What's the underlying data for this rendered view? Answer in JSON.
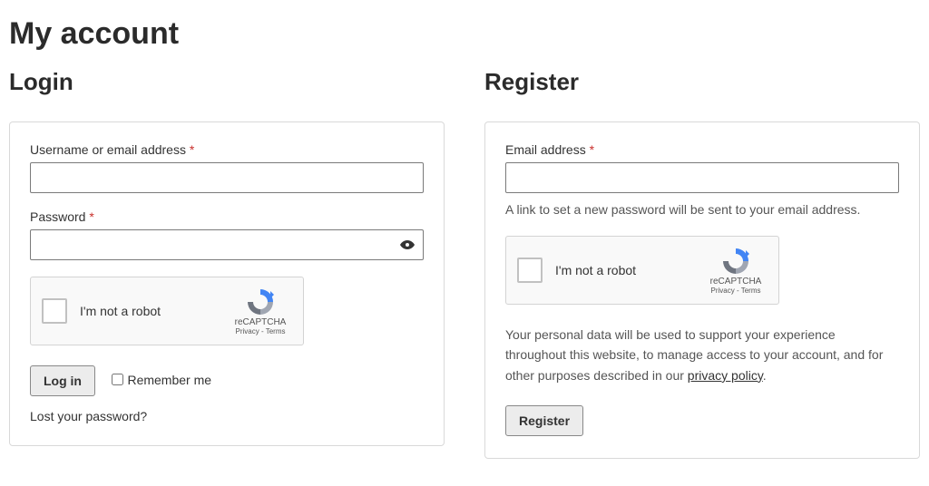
{
  "page": {
    "title": "My account"
  },
  "login": {
    "heading": "Login",
    "username_label": "Username or email address",
    "password_label": "Password",
    "required_mark": "*",
    "submit_label": "Log in",
    "remember_label": "Remember me",
    "lost_password_label": "Lost your password?"
  },
  "register": {
    "heading": "Register",
    "email_label": "Email address",
    "required_mark": "*",
    "note": "A link to set a new password will be sent to your email address.",
    "privacy_text_pre": "Your personal data will be used to support your experience throughout this website, to manage access to your account, and for other purposes described in our ",
    "privacy_link_label": "privacy policy",
    "privacy_text_post": ".",
    "submit_label": "Register"
  },
  "recaptcha": {
    "label": "I'm not a robot",
    "brand": "reCAPTCHA",
    "links": "Privacy - Terms"
  }
}
